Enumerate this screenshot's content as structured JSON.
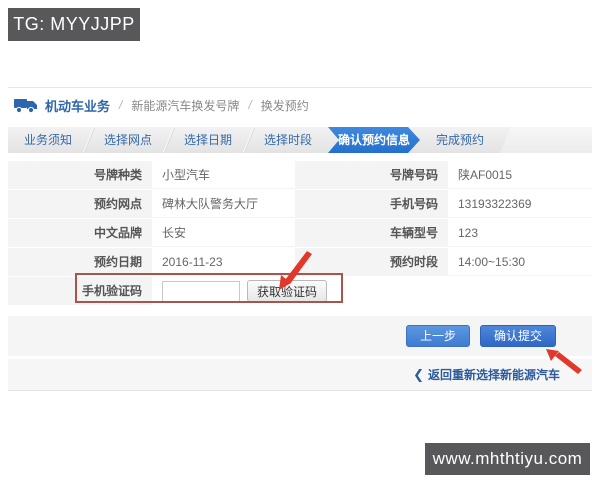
{
  "badges": {
    "top_left": "TG: MYYJJPP",
    "bottom_right": "www.mhthtiyu.com"
  },
  "breadcrumb": {
    "root": "机动车业务",
    "separator": "/",
    "level2": "新能源汽车换发号牌",
    "level3": "换发预约"
  },
  "steps": {
    "items": [
      {
        "label": "业务须知",
        "active": false
      },
      {
        "label": "选择网点",
        "active": false
      },
      {
        "label": "选择日期",
        "active": false
      },
      {
        "label": "选择时段",
        "active": false
      },
      {
        "label": "确认预约信息",
        "active": true
      },
      {
        "label": "完成预约",
        "active": false
      }
    ]
  },
  "form": {
    "rows": [
      {
        "label_left": "号牌种类",
        "value_left": "小型汽车",
        "label_right": "号牌号码",
        "value_right": "陕AF0015"
      },
      {
        "label_left": "预约网点",
        "value_left": "碑林大队警务大厅",
        "label_right": "手机号码",
        "value_right": "13193322369"
      },
      {
        "label_left": "中文品牌",
        "value_left": "长安",
        "label_right": "车辆型号",
        "value_right": "123"
      },
      {
        "label_left": "预约日期",
        "value_left": "2016-11-23",
        "label_right": "预约时段",
        "value_right": "14:00~15:30"
      }
    ],
    "captcha": {
      "label": "手机验证码",
      "input_value": "",
      "button_label": "获取验证码"
    }
  },
  "actions": {
    "prev_label": "上一步",
    "submit_label": "确认提交"
  },
  "back_link": {
    "chevron": "❮",
    "label": "返回重新选择新能源汽车"
  },
  "colors": {
    "accent_blue": "#2f74cf",
    "step_text_blue": "#3568a8",
    "annotation_red": "#e0392b",
    "badge_bg": "#58585a"
  }
}
